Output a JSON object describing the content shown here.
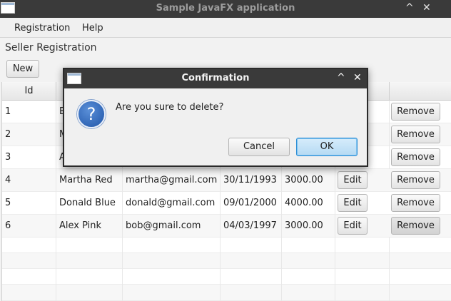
{
  "window": {
    "title": "Sample JavaFX application"
  },
  "menubar": {
    "items": [
      "Registration",
      "Help"
    ]
  },
  "page": {
    "heading": "Seller Registration",
    "new_label": "New"
  },
  "table": {
    "columns": [
      "Id",
      "",
      "",
      "",
      "",
      "",
      ""
    ],
    "rows": [
      {
        "id": "1",
        "name": "B",
        "email": "",
        "date": "",
        "amount": "",
        "edit": "",
        "remove": "Remove"
      },
      {
        "id": "2",
        "name": "M",
        "email": "",
        "date": "",
        "amount": "",
        "edit": "",
        "remove": "Remove"
      },
      {
        "id": "3",
        "name": "A",
        "email": "",
        "date": "",
        "amount": "",
        "edit": "",
        "remove": "Remove"
      },
      {
        "id": "4",
        "name": "Martha Red",
        "email": "martha@gmail.com",
        "date": "30/11/1993",
        "amount": "3000.00",
        "edit": "Edit",
        "remove": "Remove"
      },
      {
        "id": "5",
        "name": "Donald Blue",
        "email": "donald@gmail.com",
        "date": "09/01/2000",
        "amount": "4000.00",
        "edit": "Edit",
        "remove": "Remove"
      },
      {
        "id": "6",
        "name": "Alex Pink",
        "email": "bob@gmail.com",
        "date": "04/03/1997",
        "amount": "3000.00",
        "edit": "Edit",
        "remove": "Remove"
      }
    ]
  },
  "dialog": {
    "title": "Confirmation",
    "message": "Are you sure to delete?",
    "icon_glyph": "?",
    "cancel_label": "Cancel",
    "ok_label": "OK"
  },
  "controls": {
    "maximize_glyph": "^",
    "close_glyph": "✕"
  }
}
